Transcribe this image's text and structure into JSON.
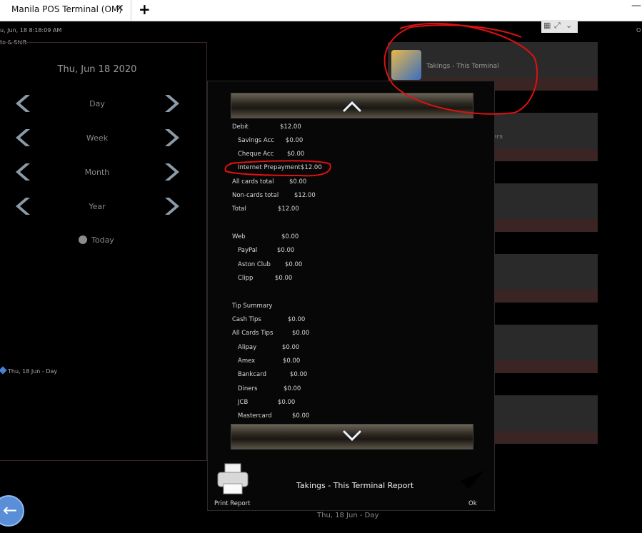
{
  "browser": {
    "tab_title": "Manila POS Terminal (OM)",
    "tab_close": "✕",
    "new_tab": "+",
    "minimize": "—"
  },
  "header": {
    "datetime": "u, Jun, 18 8:18:09 AM",
    "shift_label": "te & Shift",
    "right_label": "O"
  },
  "calendar": {
    "current_date": "Thu, Jun 18 2020",
    "periods": [
      "Day",
      "Week",
      "Month",
      "Year"
    ],
    "today_label": "Today",
    "selection_label": "Thu, 18 Jun - Day"
  },
  "tiles": {
    "takings_label": "Takings - This Terminal",
    "partial_label": "ers"
  },
  "report": {
    "lines": [
      {
        "label": "Debit",
        "value": "$12.00",
        "indent": false
      },
      {
        "label": "Savings Acc",
        "value": "$0.00",
        "indent": true
      },
      {
        "label": "Cheque Acc",
        "value": "$0.00",
        "indent": true
      },
      {
        "label": "Internet Prepayment",
        "value": "$12.00",
        "indent": true
      },
      {
        "label": "All cards total",
        "value": "$0.00",
        "indent": false
      },
      {
        "label": "Non-cards total",
        "value": "$12.00",
        "indent": false
      },
      {
        "label": "Total",
        "value": "$12.00",
        "indent": false
      },
      {
        "label": "Web",
        "value": "$0.00",
        "indent": false
      },
      {
        "label": "PayPal",
        "value": "$0.00",
        "indent": true
      },
      {
        "label": "Aston Club",
        "value": "$0.00",
        "indent": true
      },
      {
        "label": "Clipp",
        "value": "$0.00",
        "indent": true
      },
      {
        "label": "Tip Summary",
        "value": "",
        "indent": false
      },
      {
        "label": "Cash Tips",
        "value": "$0.00",
        "indent": false
      },
      {
        "label": "All Cards Tips",
        "value": "$0.00",
        "indent": false
      },
      {
        "label": "Alipay",
        "value": "$0.00",
        "indent": true
      },
      {
        "label": "Amex",
        "value": "$0.00",
        "indent": true
      },
      {
        "label": "Bankcard",
        "value": "$0.00",
        "indent": true
      },
      {
        "label": "Diners",
        "value": "$0.00",
        "indent": true
      },
      {
        "label": "JCB",
        "value": "$0.00",
        "indent": true
      },
      {
        "label": "Mastercard",
        "value": "$0.00",
        "indent": true
      }
    ],
    "title": "Takings - This Terminal Report",
    "print_label": "Print Report",
    "ok_label": "Ok",
    "footer_date": "Thu, 18 Jun - Day"
  },
  "colors": {
    "accent_check": "#4cae2c",
    "annotation_red": "#e01010",
    "back_button": "#5a8fd8"
  }
}
